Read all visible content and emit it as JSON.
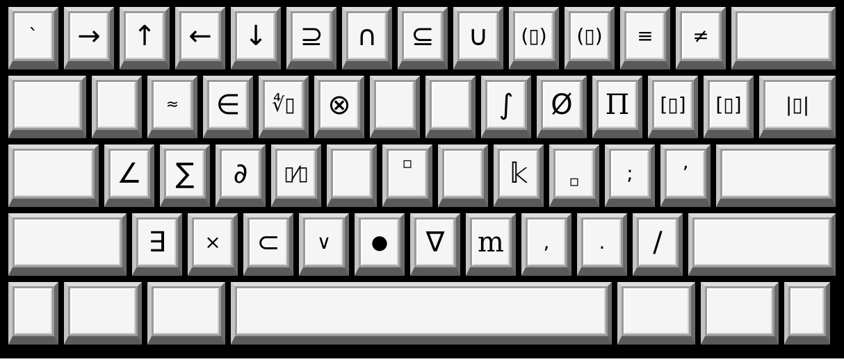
{
  "keyboard": {
    "rows": [
      [
        {
          "name": "key-grave",
          "label": "`",
          "size": "sm"
        },
        {
          "name": "key-right-arrow",
          "label": "→"
        },
        {
          "name": "key-up-arrow",
          "label": "↑"
        },
        {
          "name": "key-left-arrow",
          "label": "←"
        },
        {
          "name": "key-down-arrow",
          "label": "↓"
        },
        {
          "name": "key-superset-equal",
          "label": "⊇"
        },
        {
          "name": "key-intersection",
          "label": "∩"
        },
        {
          "name": "key-subset-equal",
          "label": "⊆"
        },
        {
          "name": "key-union",
          "label": "∪"
        },
        {
          "name": "key-parentheses-template",
          "label": "(▯)",
          "size": "sm"
        },
        {
          "name": "key-parentheses-template-alt",
          "label": "(▯)",
          "size": "sm"
        },
        {
          "name": "key-identical",
          "label": "≡",
          "size": "sm"
        },
        {
          "name": "key-not-equal",
          "label": "≠",
          "size": "sm"
        },
        {
          "name": "key-backspace",
          "label": ""
        }
      ],
      [
        {
          "name": "key-tab",
          "label": ""
        },
        {
          "name": "key-blank-q",
          "label": ""
        },
        {
          "name": "key-approx",
          "label": "≈",
          "size": "xs"
        },
        {
          "name": "key-element-of",
          "label": "∈"
        },
        {
          "name": "key-nth-root",
          "label": "∜▯",
          "size": "sm"
        },
        {
          "name": "key-circled-times",
          "label": "⊗"
        },
        {
          "name": "key-blank-t",
          "label": ""
        },
        {
          "name": "key-blank-y",
          "label": ""
        },
        {
          "name": "key-integral",
          "label": "∫"
        },
        {
          "name": "key-empty-set",
          "label": "Ø"
        },
        {
          "name": "key-product",
          "label": "Π"
        },
        {
          "name": "key-brackets-template",
          "label": "[▯]",
          "size": "sm"
        },
        {
          "name": "key-brackets-template-alt",
          "label": "[▯]",
          "size": "sm"
        },
        {
          "name": "key-abs-template",
          "label": "|▯|",
          "size": "sm"
        }
      ],
      [
        {
          "name": "key-caps-lock",
          "label": ""
        },
        {
          "name": "key-angle",
          "label": "∠"
        },
        {
          "name": "key-summation",
          "label": "∑"
        },
        {
          "name": "key-partial",
          "label": "∂"
        },
        {
          "name": "key-fraction-template",
          "label": "▯⁄▯",
          "size": "sm"
        },
        {
          "name": "key-blank-g",
          "label": ""
        },
        {
          "name": "key-superscript-template",
          "label": "▫",
          "size": "xs"
        },
        {
          "name": "key-blank-j",
          "label": ""
        },
        {
          "name": "key-double-struck-k",
          "label": "𝕜"
        },
        {
          "name": "key-subscript-template",
          "label": "▫",
          "size": "xs"
        },
        {
          "name": "key-semicolon",
          "label": ";",
          "size": "sm"
        },
        {
          "name": "key-apostrophe",
          "label": "ʼ",
          "size": "sm"
        },
        {
          "name": "key-enter",
          "label": ""
        }
      ],
      [
        {
          "name": "key-left-shift",
          "label": ""
        },
        {
          "name": "key-exists",
          "label": "∃"
        },
        {
          "name": "key-times",
          "label": "×",
          "size": "sm"
        },
        {
          "name": "key-subset",
          "label": "⊂"
        },
        {
          "name": "key-logical-or",
          "label": "∨",
          "size": "sm"
        },
        {
          "name": "key-bullet",
          "label": "●",
          "size": "sm"
        },
        {
          "name": "key-nabla",
          "label": "∇"
        },
        {
          "name": "key-m",
          "label": "m"
        },
        {
          "name": "key-comma",
          "label": ",",
          "size": "sm"
        },
        {
          "name": "key-period",
          "label": ".",
          "size": "sm"
        },
        {
          "name": "key-slash",
          "label": "/"
        },
        {
          "name": "key-right-shift",
          "label": ""
        }
      ],
      [
        {
          "name": "key-left-ctrl",
          "label": ""
        },
        {
          "name": "key-left-alt",
          "label": ""
        },
        {
          "name": "key-left-meta",
          "label": ""
        },
        {
          "name": "key-space",
          "label": ""
        },
        {
          "name": "key-right-alt",
          "label": ""
        },
        {
          "name": "key-right-meta",
          "label": ""
        },
        {
          "name": "key-right-ctrl",
          "label": ""
        }
      ]
    ]
  }
}
